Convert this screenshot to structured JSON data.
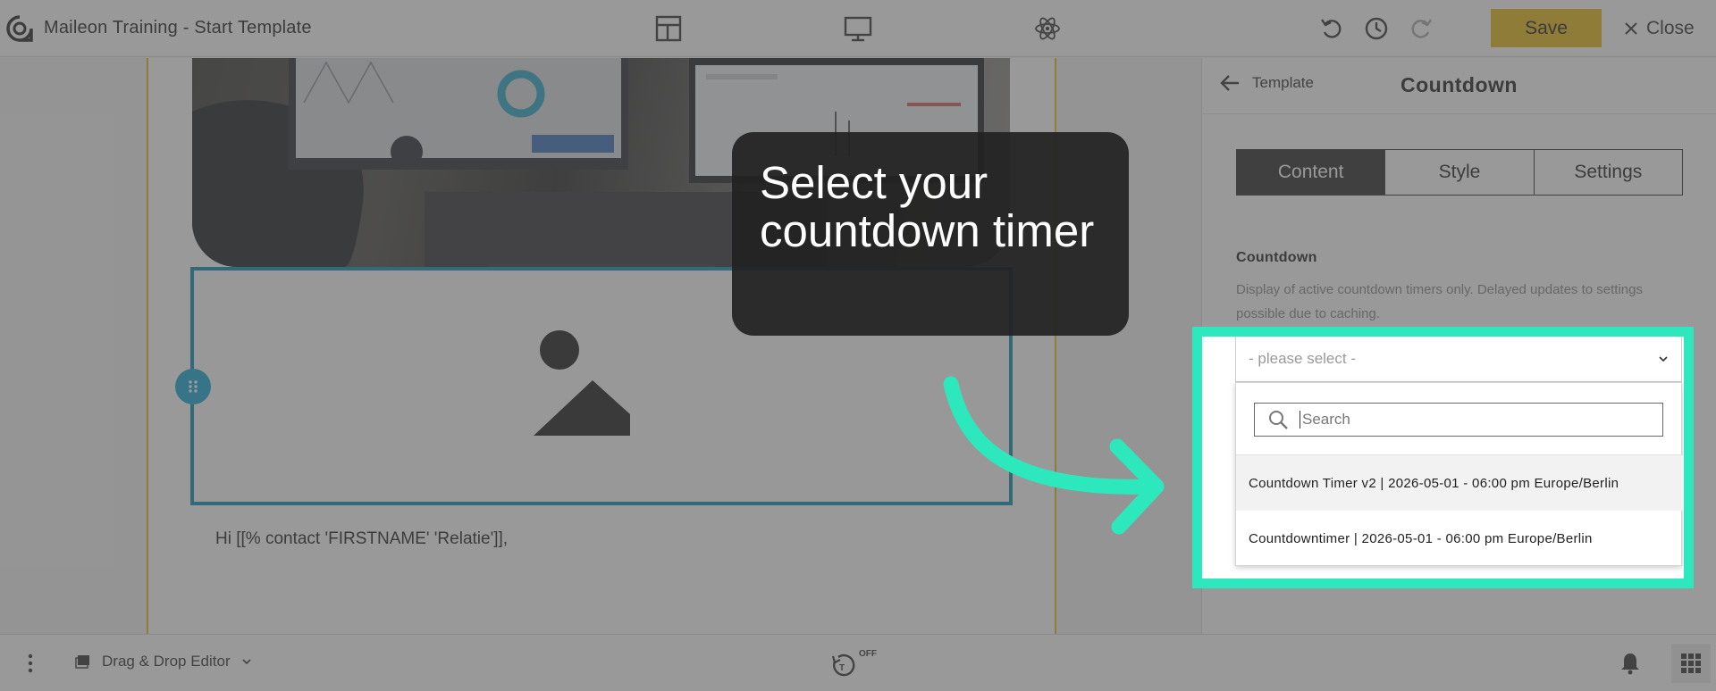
{
  "app": {
    "title": "Maileon Training - Start Template"
  },
  "toolbar": {
    "layout_icon": "layout-grid-icon",
    "desktop_icon": "desktop-monitor-icon",
    "components_icon": "atom-icon",
    "undo_icon": "undo-icon",
    "history_icon": "clock-history-icon",
    "redo_icon": "redo-icon",
    "save_label": "Save",
    "close_label": "Close"
  },
  "block_toolbar": {
    "icons": [
      "layers-icon",
      "select-block-icon",
      "settings-gear-icon",
      "duplicate-icon",
      "trash-icon"
    ]
  },
  "email": {
    "greeting": "Hi [[% contact 'FIRSTNAME' 'Relatie']],"
  },
  "panel": {
    "back_label": "Template",
    "title": "Countdown",
    "tabs": [
      {
        "label": "Content",
        "active": true
      },
      {
        "label": "Style",
        "active": false
      },
      {
        "label": "Settings",
        "active": false
      }
    ],
    "section_label": "Countdown",
    "section_desc": "Display of active countdown timers only. Delayed updates to settings possible due to caching.",
    "select_placeholder": "- please select -",
    "search_placeholder": "Search",
    "options": [
      "Countdown Timer v2 | 2026-05-01 - 06:00 pm Europe/Berlin",
      "Countdowntimer | 2026-05-01 - 06:00 pm Europe/Berlin"
    ]
  },
  "bottombar": {
    "editor_mode": "Drag & Drop Editor",
    "autosave_state": "OFF"
  },
  "tutorial": {
    "callout_text": "Select your\ncountdown timer",
    "highlight_color": "#2de8bd"
  },
  "colors": {
    "accent": "#e8b91b",
    "selection": "#0d8fb5",
    "tab_active": "#2b2b2b"
  }
}
